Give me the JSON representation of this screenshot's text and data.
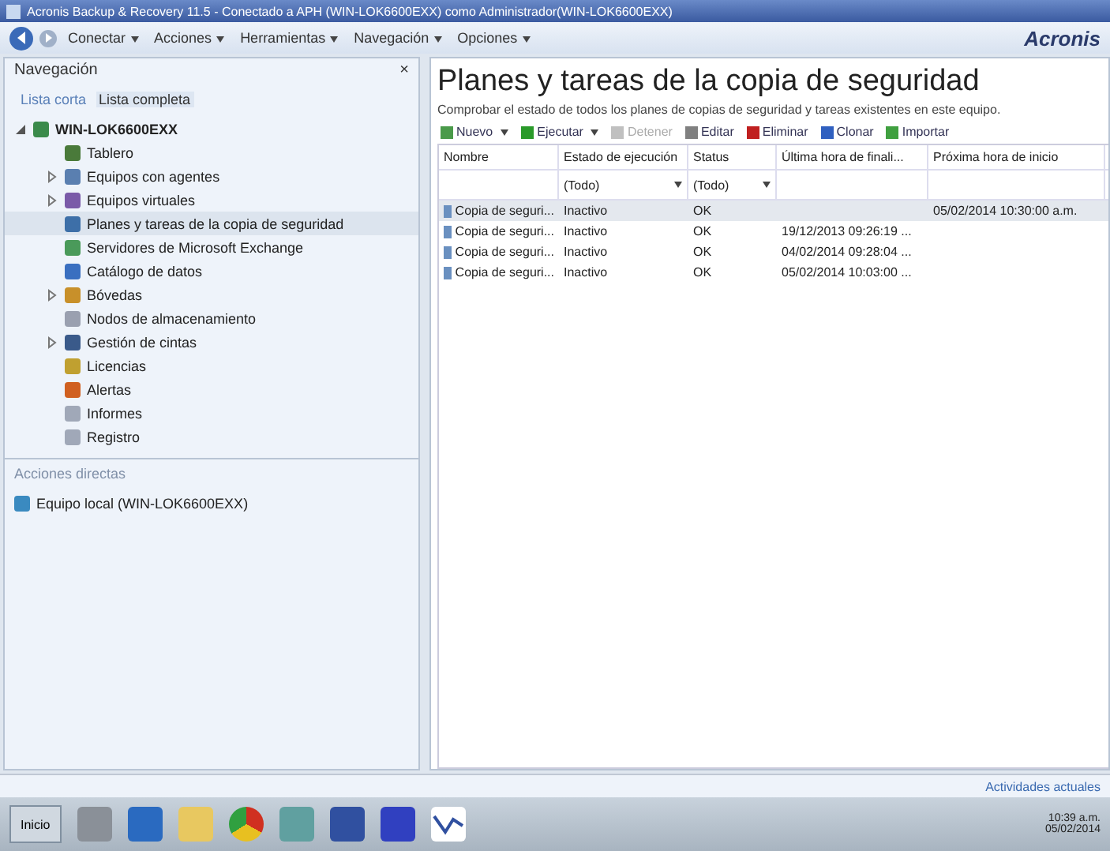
{
  "window": {
    "title": "Acronis Backup & Recovery 11.5 - Conectado a APH (WIN-LOK6600EXX) como Administrador(WIN-LOK6600EXX)"
  },
  "menu": [
    "Conectar",
    "Acciones",
    "Herramientas",
    "Navegación",
    "Opciones"
  ],
  "logo": "Acronis",
  "navigation": {
    "title": "Navegación",
    "close": "×",
    "views": [
      {
        "label": "Lista corta",
        "selected": false
      },
      {
        "label": "Lista completa",
        "selected": true
      }
    ],
    "tree": [
      {
        "label": "WIN-LOK6600EXX",
        "expanded": true,
        "selected": false,
        "children": [
          {
            "label": "Tablero",
            "selected": false
          },
          {
            "label": "Equipos con agentes",
            "selected": false,
            "expanded": false
          },
          {
            "label": "Equipos virtuales",
            "selected": false,
            "expanded": false
          },
          {
            "label": "Planes y tareas de la copia de seguridad",
            "selected": true
          },
          {
            "label": "Servidores de Microsoft Exchange",
            "selected": false
          },
          {
            "label": "Catálogo de datos",
            "selected": false
          },
          {
            "label": "Bóvedas",
            "selected": false,
            "expanded": false
          },
          {
            "label": "Nodos de almacenamiento",
            "selected": false
          },
          {
            "label": "Gestión de cintas",
            "selected": false,
            "expanded": false
          },
          {
            "label": "Licencias",
            "selected": false
          },
          {
            "label": "Alertas",
            "selected": false
          },
          {
            "label": "Informes",
            "selected": false
          },
          {
            "label": "Registro",
            "selected": false
          }
        ]
      }
    ],
    "shortcuts_title": "Acciones directas",
    "shortcuts": [
      "Equipo local (WIN-LOK6600EXX)"
    ]
  },
  "main": {
    "title": "Planes y tareas de la copia de seguridad",
    "subtitle": "Comprobar el estado de todos los planes de copias de seguridad y tareas existentes en este equipo.",
    "toolbar": [
      {
        "label": "Nuevo",
        "disabled": false,
        "dropdown": true
      },
      {
        "label": "Ejecutar",
        "disabled": false,
        "dropdown": true
      },
      {
        "label": "Detener",
        "disabled": true,
        "dropdown": false
      },
      {
        "label": "Editar",
        "disabled": false,
        "dropdown": false
      },
      {
        "label": "Eliminar",
        "disabled": false,
        "dropdown": false
      },
      {
        "label": "Clonar",
        "disabled": false,
        "dropdown": false
      },
      {
        "label": "Importar",
        "disabled": false,
        "dropdown": false
      }
    ],
    "table": {
      "columns": [
        {
          "label": "Nombre"
        },
        {
          "label": "Estado de ejecución",
          "filter": "(Todo)"
        },
        {
          "label": "Status",
          "filter": "(Todo)"
        },
        {
          "label": "Última hora de finali..."
        },
        {
          "label": "Próxima hora de inicio"
        }
      ],
      "rows": [
        {
          "selected": true,
          "cells": [
            "Copia de seguri...",
            "Inactivo",
            "OK",
            null,
            "05/02/2014 10:30:00 a.m."
          ]
        },
        {
          "selected": false,
          "cells": [
            "Copia de seguri...",
            "Inactivo",
            "OK",
            "19/12/2013 09:26:19 ...",
            null
          ]
        },
        {
          "selected": false,
          "cells": [
            "Copia de seguri...",
            "Inactivo",
            "OK",
            "04/02/2014 09:28:04 ...",
            null
          ]
        },
        {
          "selected": false,
          "cells": [
            "Copia de seguri...",
            "Inactivo",
            "OK",
            "05/02/2014 10:03:00 ...",
            null
          ]
        }
      ]
    }
  },
  "status_bar": {
    "activity": "Actividades actuales"
  },
  "taskbar": {
    "start": "Inicio",
    "time": "10:39 a.m.",
    "date": "05/02/2014"
  }
}
